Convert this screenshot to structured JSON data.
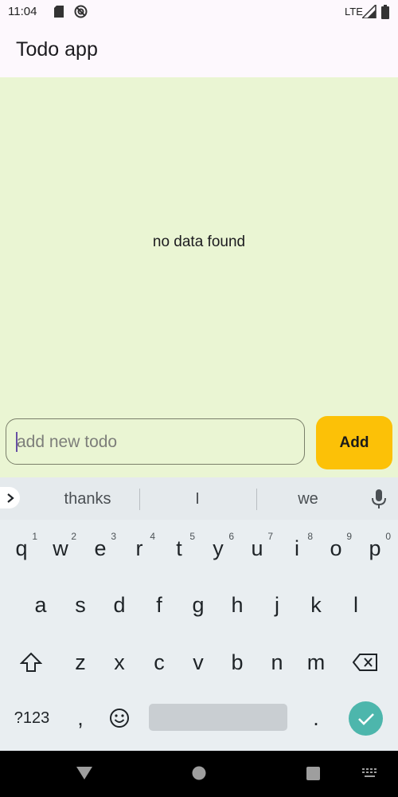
{
  "status_bar": {
    "time": "11:04",
    "network": "LTE",
    "icons": [
      "sd-card-icon",
      "vpn-icon",
      "signal-icon",
      "battery-icon"
    ]
  },
  "app_bar": {
    "title": "Todo app"
  },
  "body": {
    "empty_text": "no data found",
    "input": {
      "placeholder": "add new todo",
      "value": ""
    },
    "add_button": "Add"
  },
  "keyboard": {
    "suggestions": [
      "thanks",
      "I",
      "we"
    ],
    "row1": [
      {
        "key": "q",
        "hint": "1"
      },
      {
        "key": "w",
        "hint": "2"
      },
      {
        "key": "e",
        "hint": "3"
      },
      {
        "key": "r",
        "hint": "4"
      },
      {
        "key": "t",
        "hint": "5"
      },
      {
        "key": "y",
        "hint": "6"
      },
      {
        "key": "u",
        "hint": "7"
      },
      {
        "key": "i",
        "hint": "8"
      },
      {
        "key": "o",
        "hint": "9"
      },
      {
        "key": "p",
        "hint": "0"
      }
    ],
    "row2": [
      "a",
      "s",
      "d",
      "f",
      "g",
      "h",
      "j",
      "k",
      "l"
    ],
    "row3": [
      "z",
      "x",
      "c",
      "v",
      "b",
      "n",
      "m"
    ],
    "symbols_key": "?123",
    "comma_key": ",",
    "period_key": "."
  },
  "colors": {
    "body_bg": "#eaf5d3",
    "accent": "#fcc107",
    "enter_key": "#4db6ac"
  }
}
